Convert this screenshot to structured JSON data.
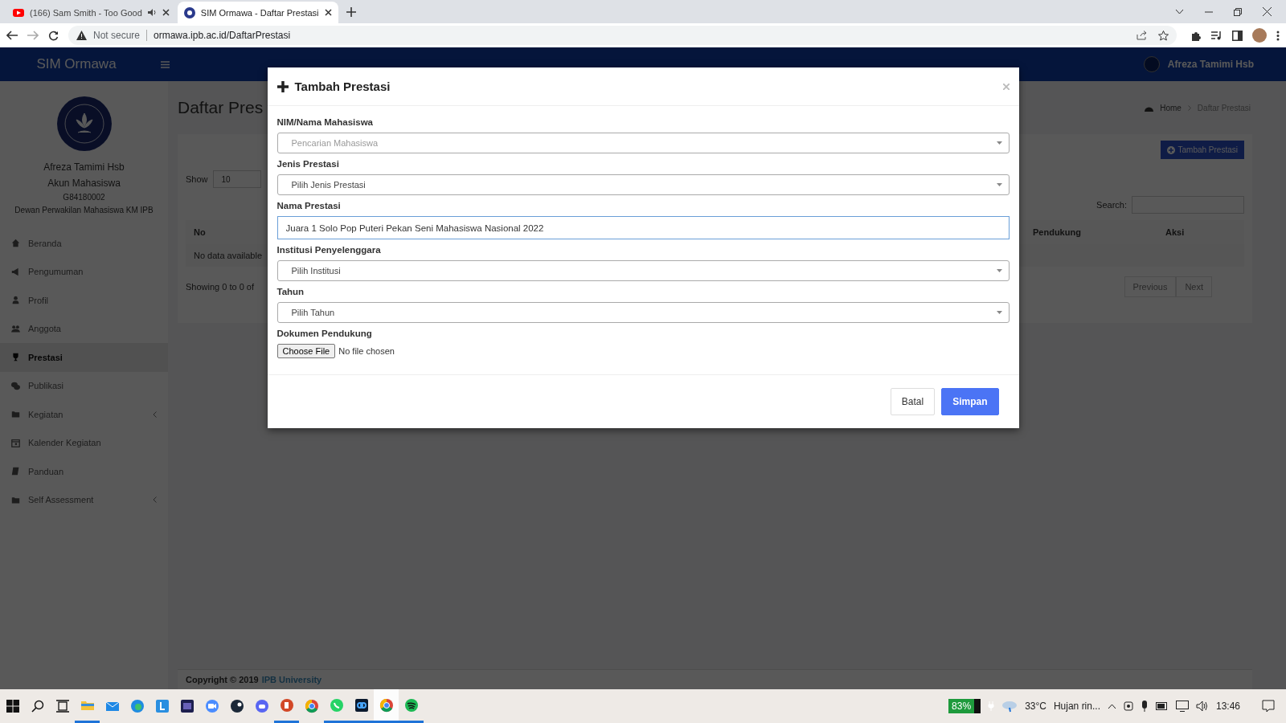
{
  "browser": {
    "tabs": [
      {
        "title": "(166) Sam Smith - Too Good",
        "selected": false,
        "audio": true
      },
      {
        "title": "SIM Ormawa - Daftar Prestasi",
        "selected": true,
        "audio": false
      }
    ],
    "not_secure": "Not secure",
    "url": "ormawa.ipb.ac.id/DaftarPrestasi"
  },
  "header": {
    "brand": "SIM Ormawa",
    "user": "Afreza Tamimi Hsb"
  },
  "sidebar": {
    "name": "Afreza Tamimi Hsb",
    "role": "Akun Mahasiswa",
    "nim": "G84180002",
    "organization": "Dewan Perwakilan Mahasiswa KM IPB",
    "items": [
      {
        "label": "Beranda",
        "selected": false,
        "has_submenu": false
      },
      {
        "label": "Pengumuman",
        "selected": false,
        "has_submenu": false
      },
      {
        "label": "Profil",
        "selected": false,
        "has_submenu": false
      },
      {
        "label": "Anggota",
        "selected": false,
        "has_submenu": false
      },
      {
        "label": "Prestasi",
        "selected": true,
        "has_submenu": false
      },
      {
        "label": "Publikasi",
        "selected": false,
        "has_submenu": false
      },
      {
        "label": "Kegiatan",
        "selected": false,
        "has_submenu": true
      },
      {
        "label": "Kalender Kegiatan",
        "selected": false,
        "has_submenu": false
      },
      {
        "label": "Panduan",
        "selected": false,
        "has_submenu": false
      },
      {
        "label": "Self Assessment",
        "selected": false,
        "has_submenu": true
      }
    ]
  },
  "content": {
    "title": "Daftar Pres",
    "breadcrumb": [
      "Home",
      "Daftar Prestasi"
    ],
    "add_button": "Tambah Prestasi",
    "show_label": "Show",
    "page_size": "10",
    "search_label": "Search:",
    "table": {
      "columns": [
        "No",
        "Pendukung",
        "Aksi"
      ],
      "empty_row": "No data available"
    },
    "info": "Showing 0 to 0 of",
    "pagination": [
      "Previous",
      "Next"
    ]
  },
  "footer": {
    "text": "Copyright © 2019",
    "link": "IPB University"
  },
  "modal": {
    "title": "Tambah Prestasi",
    "fields": [
      {
        "label": "NIM/Nama Mahasiswa",
        "kind": "select",
        "placeholder": "Pencarian Mahasiswa"
      },
      {
        "label": "Jenis Prestasi",
        "kind": "select",
        "value": "Pilih Jenis Prestasi"
      },
      {
        "label": "Nama Prestasi",
        "kind": "text",
        "value": "Juara 1 Solo Pop Puteri Pekan Seni Mahasiswa Nasional 2022"
      },
      {
        "label": "Institusi Penyelenggara",
        "kind": "select",
        "value": "Pilih Institusi"
      },
      {
        "label": "Tahun",
        "kind": "select",
        "value": "Pilih Tahun"
      },
      {
        "label": "Dokumen Pendukung",
        "kind": "file",
        "button": "Choose File",
        "status": "No file chosen"
      }
    ],
    "buttons": [
      {
        "label": "Batal",
        "kind": "default"
      },
      {
        "label": "Simpan",
        "kind": "primary"
      }
    ]
  },
  "taskbar": {
    "apps": [
      {
        "running": true,
        "selected": false
      },
      {
        "running": false,
        "selected": false
      },
      {
        "running": false,
        "selected": false
      },
      {
        "running": false,
        "selected": false
      },
      {
        "running": false,
        "selected": false
      },
      {
        "running": false,
        "selected": false
      },
      {
        "running": false,
        "selected": false
      },
      {
        "running": false,
        "selected": false
      },
      {
        "running": true,
        "selected": false
      },
      {
        "running": false,
        "selected": false
      },
      {
        "running": true,
        "selected": false
      },
      {
        "running": true,
        "selected": false
      },
      {
        "running": true,
        "selected": true
      },
      {
        "running": true,
        "selected": false
      }
    ],
    "battery": "83%",
    "temperature": "33°C",
    "weather": "Hujan rin...",
    "time": "13:46"
  }
}
